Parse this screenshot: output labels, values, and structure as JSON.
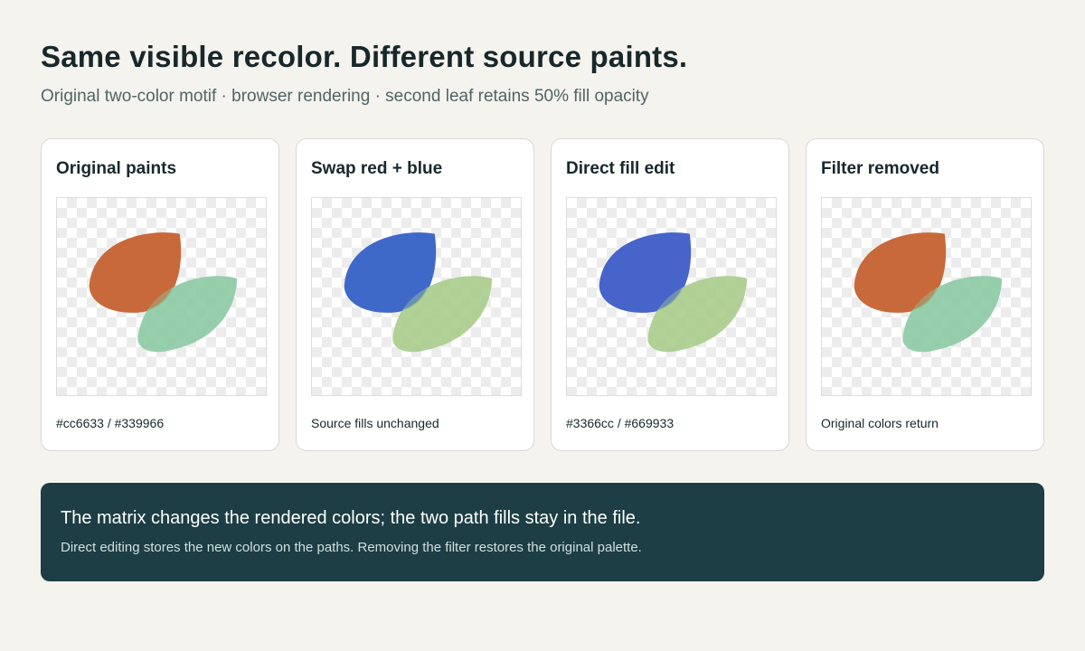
{
  "title": "Same visible recolor. Different source paints.",
  "subtitle": "Original two-color motif · browser rendering · second leaf retains 50% fill opacity",
  "cards": [
    {
      "title": "Original paints",
      "caption": "#cc6633 / #339966",
      "leaf1_color": "#c8693b",
      "leaf2_color": "#8ccaa4"
    },
    {
      "title": "Swap red + blue",
      "caption": "Source fills unchanged",
      "leaf1_color": "#3f69c8",
      "leaf2_color": "#a9cc8c"
    },
    {
      "title": "Direct fill edit",
      "caption": "#3366cc / #669933",
      "leaf1_color": "#4764cb",
      "leaf2_color": "#a9cc8c"
    },
    {
      "title": "Filter removed",
      "caption": "Original colors return",
      "leaf1_color": "#c8693b",
      "leaf2_color": "#8ccaa4"
    }
  ],
  "callout": {
    "title": "The matrix changes the rendered colors; the two path fills stay in the file.",
    "body": "Direct editing stores the new colors on the paths. Removing the filter restores the original palette."
  }
}
